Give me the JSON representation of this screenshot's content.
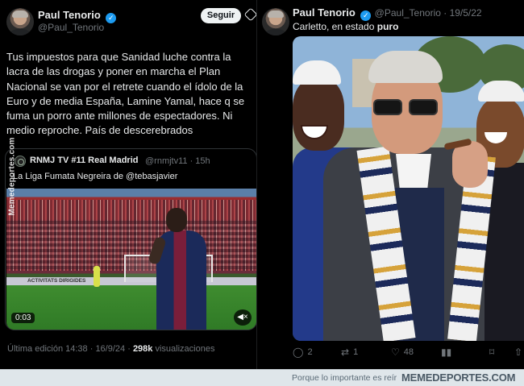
{
  "left_tweet": {
    "author_name": "Paul Tenorio",
    "author_handle": "@Paul_Tenorio",
    "follow_label": "Seguir",
    "text": "Tus impuestos para que Sanidad luche contra la lacra de las drogas y poner en marcha el Plan Nacional se van por el retrete cuando el ídolo de la Euro y de media España, Lamine Yamal, hace q se fuma un porro ante millones de espectadores. Ni medio reproche. País de descerebrados",
    "quote": {
      "author_name": "RNMJ TV #11 Real Madrid",
      "author_handle": "@rnmjtv11 · 15h",
      "text": "La Liga Fumata Negreira de @tebasjavier",
      "adboard_text": "ACTIVITATS DIRIGIDES",
      "video_time": "0:03"
    },
    "meta_prefix": "Última edición 14:38 · 16/9/24 ·",
    "views_count": "298k",
    "views_label": "visualizaciones"
  },
  "right_tweet": {
    "author_name": "Paul Tenorio",
    "author_handle": "@Paul_Tenorio · 19/5/22",
    "text_prefix": "Carletto, en estado",
    "text_bold": "puro",
    "actions": {
      "replies": "2",
      "retweets": "1",
      "likes": "48"
    }
  },
  "watermark": {
    "vertical": "Memedeportes.com",
    "footer_tagline": "Porque lo importante es reír",
    "footer_logo": "MEMEDEPORTES.COM"
  },
  "icons": [
    "verified-icon",
    "grok-icon",
    "mute-icon",
    "reply-icon",
    "retweet-icon",
    "like-icon",
    "views-icon",
    "bookmark-icon",
    "share-icon"
  ],
  "colors": {
    "background": "#000000",
    "text": "#e7e9ea",
    "muted": "#71767b",
    "verified": "#1d9bf0",
    "follow_button": "#eff3f4",
    "footer_bg": "#dfe6ea"
  }
}
